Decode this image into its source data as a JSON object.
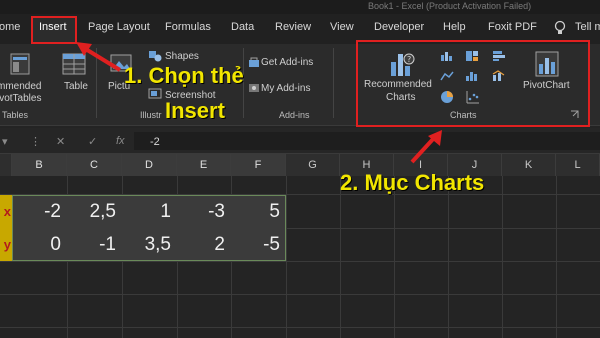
{
  "title_bar": {
    "text": "Book1 - Excel (Product Activation Failed)"
  },
  "tabs": [
    {
      "label": "ome"
    },
    {
      "label": "Insert"
    },
    {
      "label": "Page Layout"
    },
    {
      "label": "Formulas"
    },
    {
      "label": "Data"
    },
    {
      "label": "Review"
    },
    {
      "label": "View"
    },
    {
      "label": "Developer"
    },
    {
      "label": "Help"
    },
    {
      "label": "Foxit PDF"
    },
    {
      "label": "Tell m"
    }
  ],
  "ribbon": {
    "tables": {
      "recommended_line1": "mmended",
      "recommended_line2": "ivotTables",
      "table": "Table",
      "group_label": "Tables"
    },
    "illustrations": {
      "pictures": "Pictu",
      "shapes": "Shapes",
      "screenshot": "Screenshot",
      "group_label": "Illustr"
    },
    "addins": {
      "get": "Get Add-ins",
      "my": "My Add-ins",
      "group_label": "Add-ins"
    },
    "charts": {
      "recommended_line1": "Recommended",
      "recommended_line2": "Charts",
      "pivotchart": "PivotChart",
      "group_label": "Charts"
    }
  },
  "formula_bar": {
    "cancel": "✕",
    "enter": "✓",
    "fx": "fx",
    "value": "-2"
  },
  "sheet": {
    "columns": [
      "B",
      "C",
      "D",
      "E",
      "F",
      "G",
      "H",
      "I",
      "J",
      "K",
      "L"
    ],
    "rows": [
      {
        "caption": "x",
        "values": [
          "-2",
          "2,5",
          "1",
          "-3",
          "5"
        ]
      },
      {
        "caption": "y",
        "values": [
          "0",
          "-1",
          "3,5",
          "2",
          "-5"
        ]
      }
    ]
  },
  "annotations": {
    "step1_line1": "1. Chọn thẻ",
    "step1_line2": "Insert",
    "step2": "2. Mục Charts"
  },
  "colors": {
    "highlight": "#e02020",
    "annotation": "#f2e600",
    "row_caption_bg": "#c8a800"
  }
}
